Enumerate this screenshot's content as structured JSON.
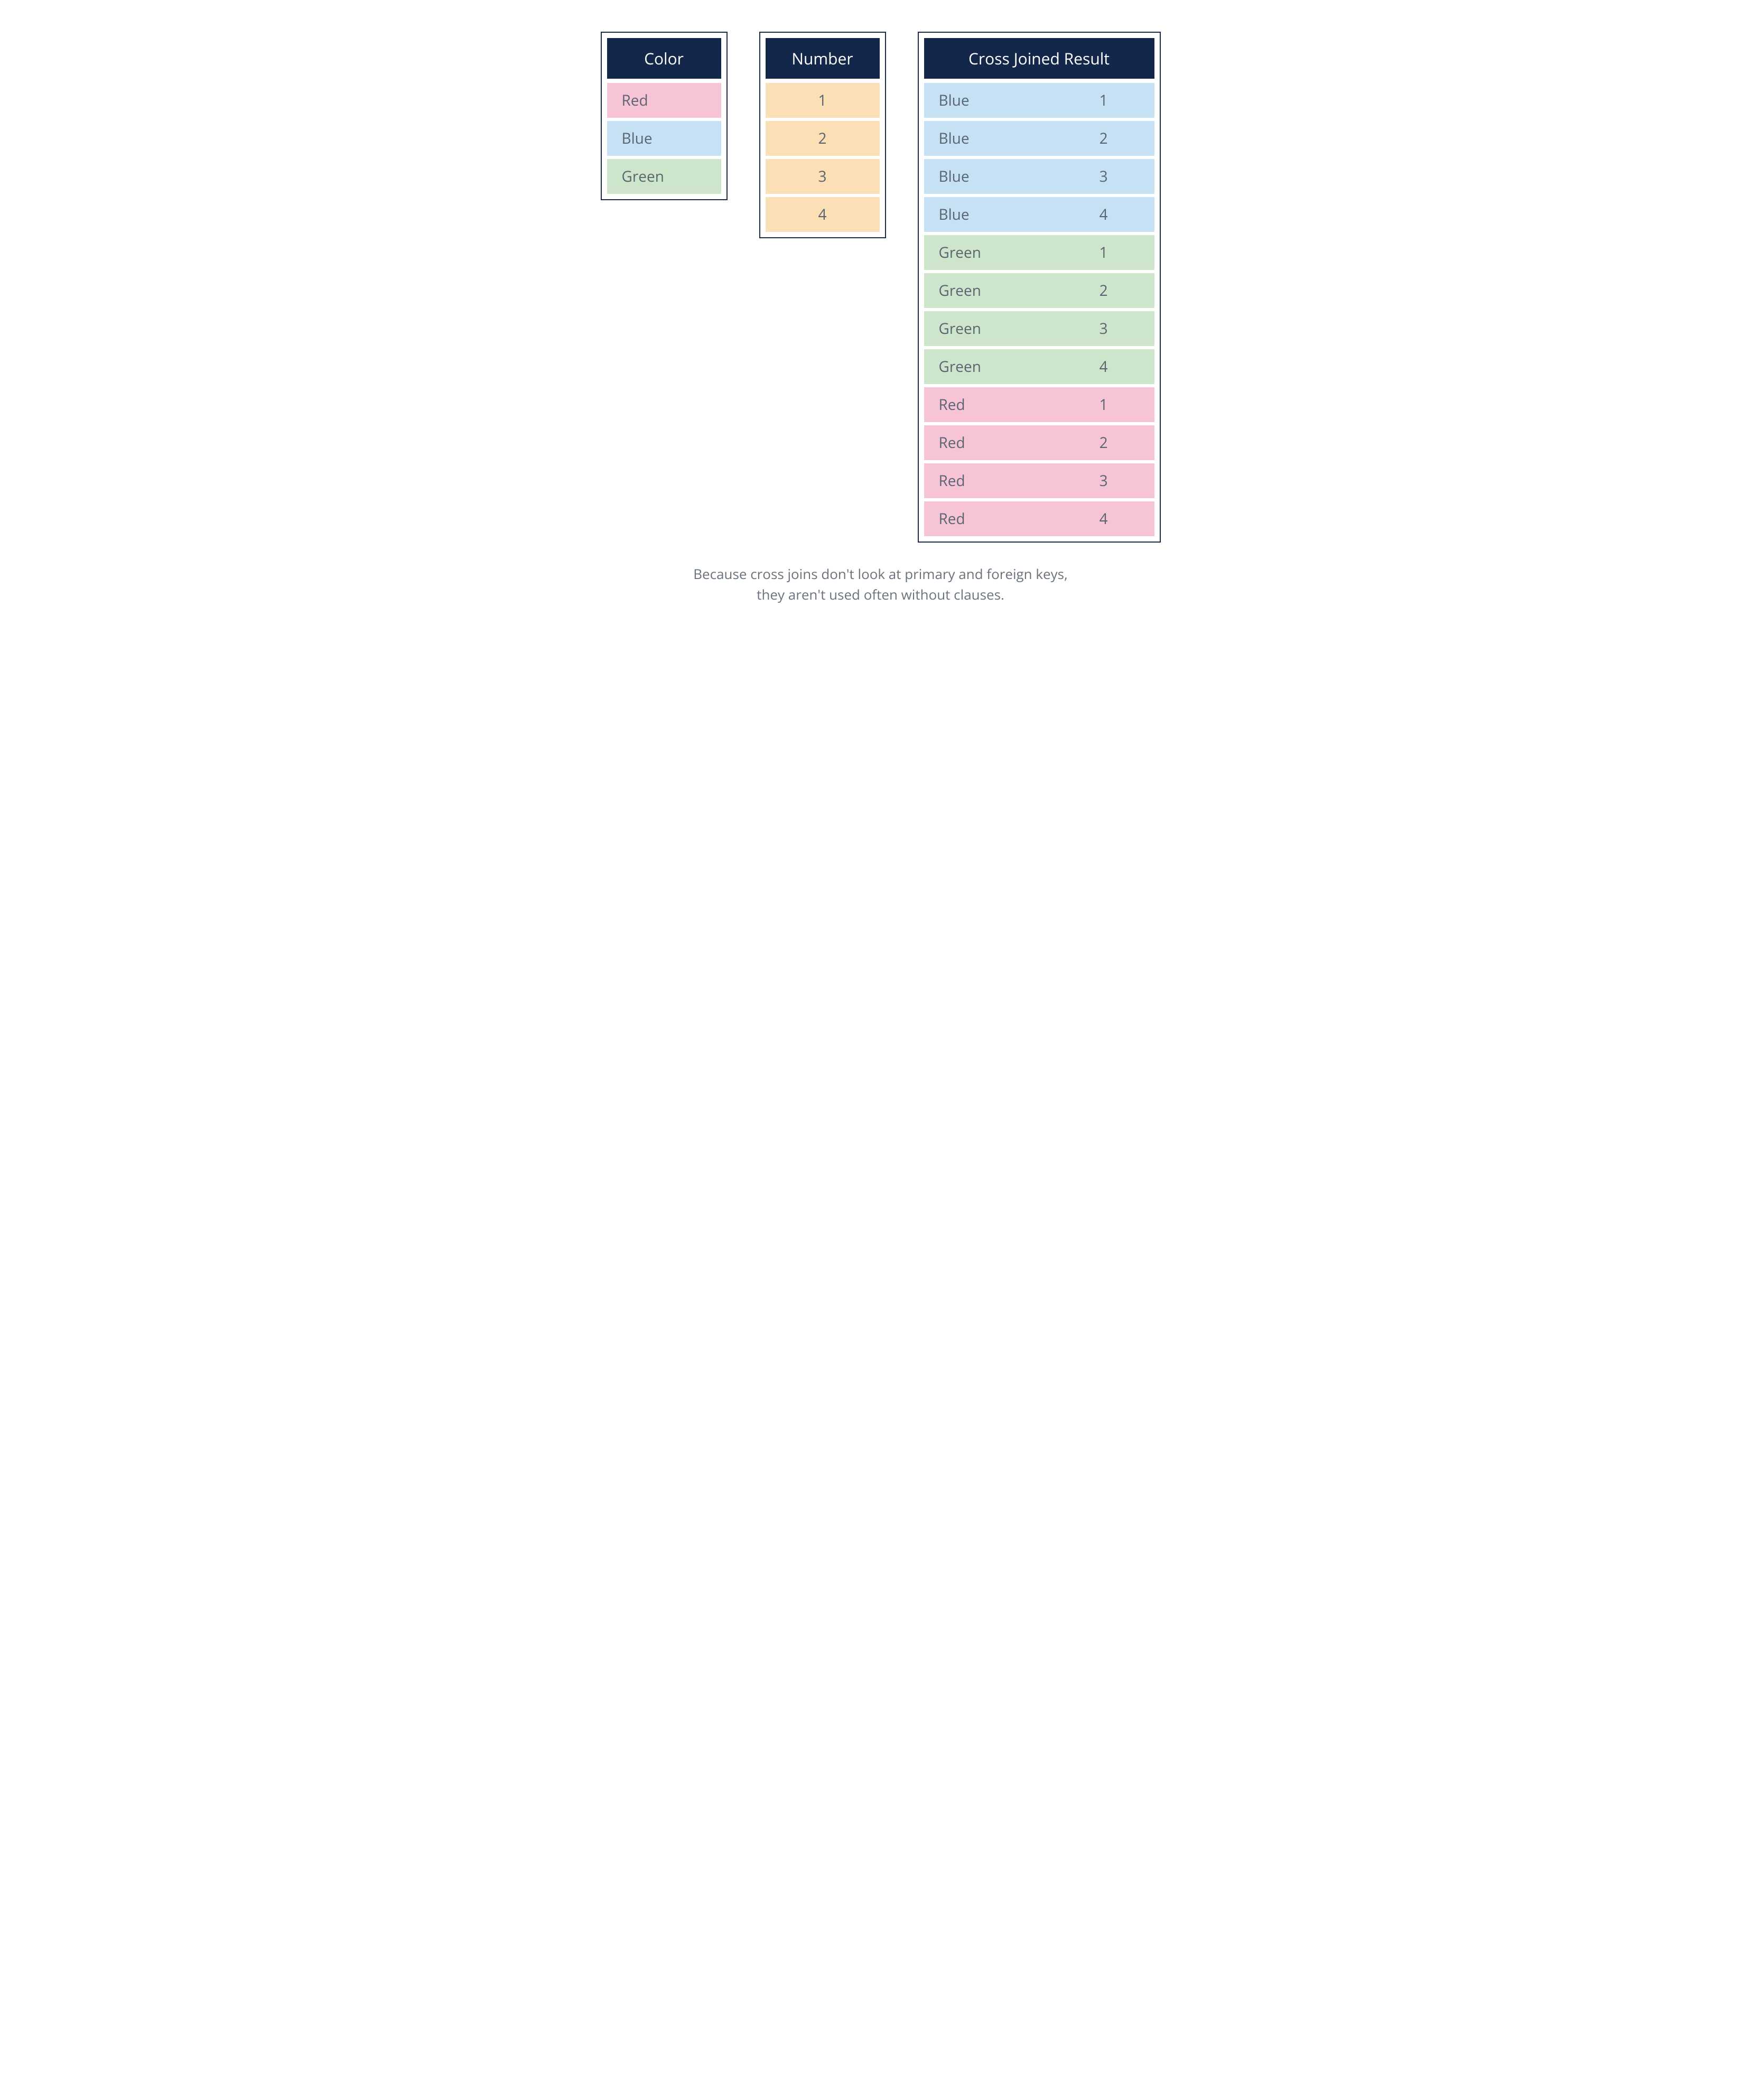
{
  "palette": {
    "Red": "#f6c4d5",
    "Blue": "#c5e1f3",
    "Green": "#cde5cb",
    "Number": "#fbe0b6",
    "header": "#12274a"
  },
  "tables": {
    "color": {
      "header": "Color",
      "rows": [
        "Red",
        "Blue",
        "Green"
      ]
    },
    "number": {
      "header": "Number",
      "rows": [
        "1",
        "2",
        "3",
        "4"
      ]
    },
    "result": {
      "header": "Cross Joined Result",
      "rows": [
        {
          "color": "Blue",
          "number": "1"
        },
        {
          "color": "Blue",
          "number": "2"
        },
        {
          "color": "Blue",
          "number": "3"
        },
        {
          "color": "Blue",
          "number": "4"
        },
        {
          "color": "Green",
          "number": "1"
        },
        {
          "color": "Green",
          "number": "2"
        },
        {
          "color": "Green",
          "number": "3"
        },
        {
          "color": "Green",
          "number": "4"
        },
        {
          "color": "Red",
          "number": "1"
        },
        {
          "color": "Red",
          "number": "2"
        },
        {
          "color": "Red",
          "number": "3"
        },
        {
          "color": "Red",
          "number": "4"
        }
      ]
    }
  },
  "caption": {
    "line1": "Because cross joins don't look at primary and foreign keys,",
    "line2": "they aren't used often without clauses."
  }
}
